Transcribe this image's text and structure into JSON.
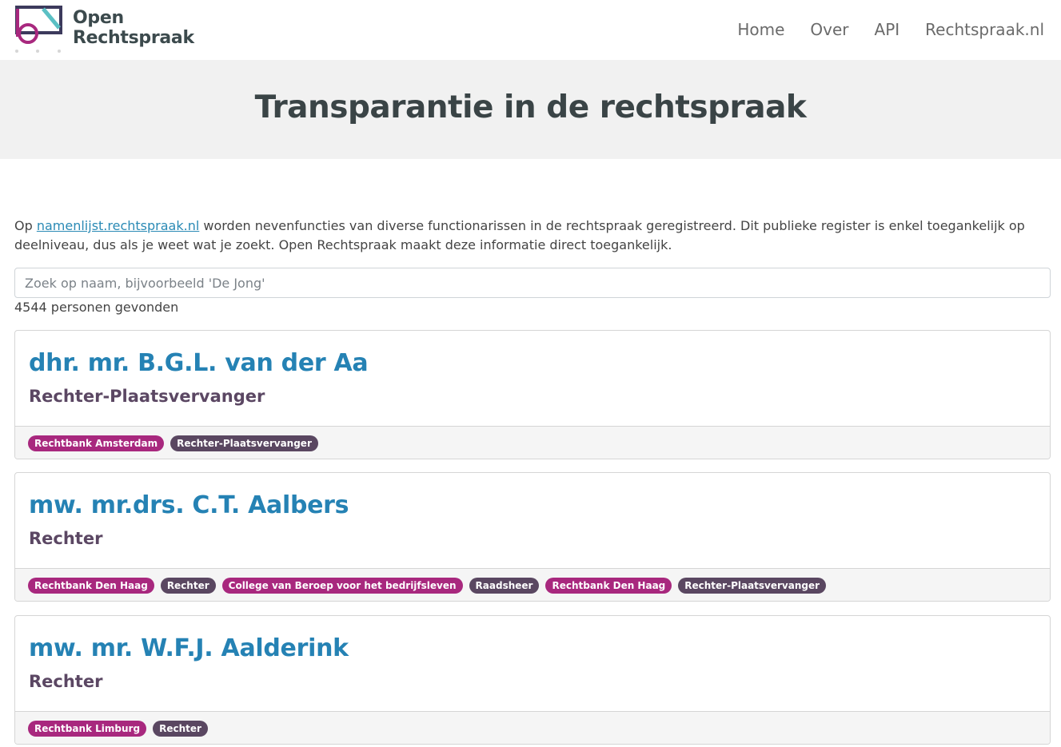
{
  "header": {
    "brand_line1": "Open",
    "brand_line2": "Rechtspraak",
    "nav": [
      "Home",
      "Over",
      "API",
      "Rechtspraak.nl"
    ]
  },
  "hero": {
    "title": "Transparantie in de rechtspraak"
  },
  "intro": {
    "prefix": "Op ",
    "link": "namenlijst.rechtspraak.nl",
    "suffix": " worden nevenfuncties van diverse functionarissen in de rechtspraak geregistreerd. Dit publieke register is enkel toegankelijk op deelniveau, dus als je weet wat je zoekt. Open Rechtspraak maakt deze informatie direct toegankelijk."
  },
  "search": {
    "placeholder": "Zoek op naam, bijvoorbeeld 'De Jong'",
    "value": ""
  },
  "results": {
    "count_text": "4544 personen gevonden"
  },
  "people": [
    {
      "name": "dhr. mr. B.G.L. van der Aa",
      "role": "Rechter-Plaatsvervanger",
      "badges": [
        {
          "label": "Rechtbank Amsterdam",
          "kind": "court"
        },
        {
          "label": "Rechter-Plaatsvervanger",
          "kind": "role"
        }
      ]
    },
    {
      "name": "mw. mr.drs. C.T. Aalbers",
      "role": "Rechter",
      "badges": [
        {
          "label": "Rechtbank Den Haag",
          "kind": "court"
        },
        {
          "label": "Rechter",
          "kind": "role"
        },
        {
          "label": "College van Beroep voor het bedrijfsleven",
          "kind": "court"
        },
        {
          "label": "Raadsheer",
          "kind": "role"
        },
        {
          "label": "Rechtbank Den Haag",
          "kind": "court"
        },
        {
          "label": "Rechter-Plaatsvervanger",
          "kind": "role"
        }
      ]
    },
    {
      "name": "mw. mr. W.F.J. Aalderink",
      "role": "Rechter",
      "badges": [
        {
          "label": "Rechtbank Limburg",
          "kind": "court"
        },
        {
          "label": "Rechter",
          "kind": "role"
        }
      ]
    }
  ],
  "colors": {
    "link_blue": "#2582b4",
    "court_badge": "#a8287e",
    "role_badge": "#5a4761",
    "hero_bg": "#f1f1f1"
  }
}
